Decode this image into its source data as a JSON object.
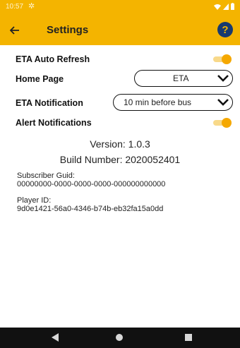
{
  "status": {
    "time": "10:57"
  },
  "header": {
    "title": "Settings",
    "help_label": "?"
  },
  "settings": {
    "eta_auto_refresh": {
      "label": "ETA Auto Refresh",
      "enabled": true
    },
    "home_page": {
      "label": "Home Page",
      "value": "ETA"
    },
    "eta_notification": {
      "label": "ETA Notification",
      "value": "10 min before bus"
    },
    "alert_notifications": {
      "label": "Alert Notifications",
      "enabled": true
    }
  },
  "about": {
    "version": "Version: 1.0.3",
    "build": "Build Number: 2020052401",
    "subscriber_label": "Subscriber Guid:",
    "subscriber_value": "00000000-0000-0000-0000-000000000000",
    "player_label": "Player ID:",
    "player_value": "9d0e1421-56a0-4346-b74b-eb32fa15a0dd"
  },
  "colors": {
    "accent": "#f4b400",
    "help": "#173a70",
    "nav": "#111111"
  },
  "icons": [
    "gear-icon",
    "wifi-icon",
    "signal-icon",
    "battery-icon",
    "back-arrow-icon",
    "help-icon",
    "chevron-down-icon",
    "nav-back-icon",
    "nav-home-icon",
    "nav-recent-icon"
  ]
}
